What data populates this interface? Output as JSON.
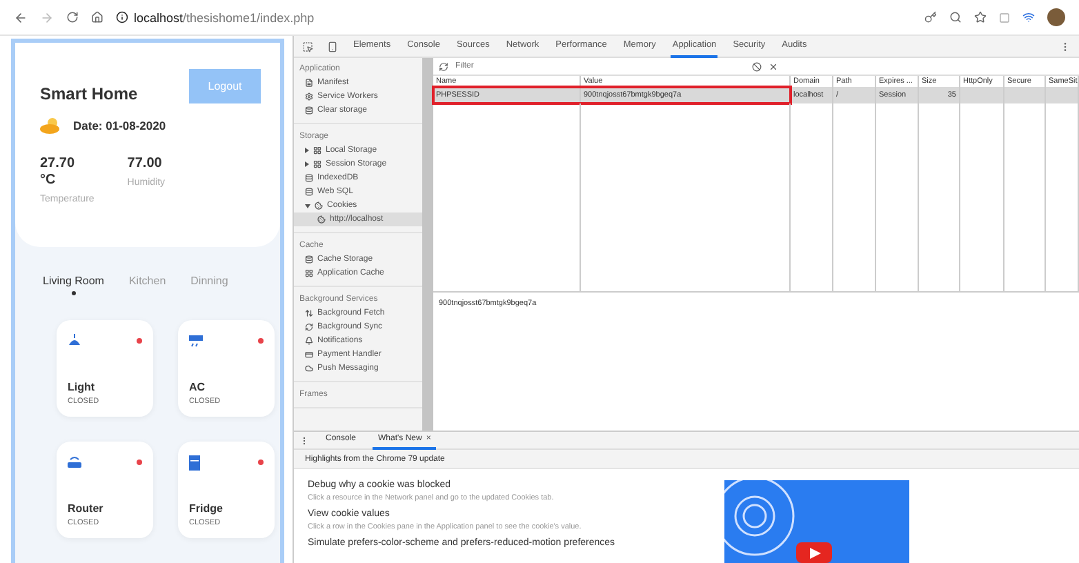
{
  "browser": {
    "url_host": "localhost",
    "url_path": "/thesishome1/index.php"
  },
  "app": {
    "title": "Smart Home",
    "logout": "Logout",
    "date": "Date: 01-08-2020",
    "readings": [
      {
        "value": "27.70 °C",
        "label": "Temperature"
      },
      {
        "value": "77.00",
        "label": "Humidity"
      }
    ],
    "rooms": [
      {
        "label": "Living Room",
        "selected": true
      },
      {
        "label": "Kitchen",
        "selected": false
      },
      {
        "label": "Dinning",
        "selected": false
      }
    ],
    "devices": [
      {
        "kind": "lamp",
        "name": "Light",
        "status": "CLOSED",
        "on": false
      },
      {
        "kind": "ac",
        "name": "AC",
        "status": "CLOSED",
        "on": false
      },
      {
        "kind": "router",
        "name": "Router",
        "status": "CLOSED",
        "on": false
      },
      {
        "kind": "fridge",
        "name": "Fridge",
        "status": "CLOSED",
        "on": false
      }
    ]
  },
  "devtools": {
    "tabs": [
      {
        "label": "Elements",
        "selected": false
      },
      {
        "label": "Console",
        "selected": false
      },
      {
        "label": "Sources",
        "selected": false
      },
      {
        "label": "Network",
        "selected": false
      },
      {
        "label": "Performance",
        "selected": false
      },
      {
        "label": "Memory",
        "selected": false
      },
      {
        "label": "Application",
        "selected": true
      },
      {
        "label": "Security",
        "selected": false
      },
      {
        "label": "Audits",
        "selected": false
      }
    ],
    "sidebar": [
      {
        "title": "Application",
        "items": [
          {
            "kind": "document",
            "label": "Manifest",
            "selected": false
          },
          {
            "kind": "gear",
            "label": "Service Workers",
            "selected": false
          },
          {
            "kind": "storage",
            "label": "Clear storage",
            "selected": false
          }
        ]
      },
      {
        "title": "Storage",
        "items": [
          {
            "kind": "table",
            "label": "Local Storage",
            "selected": false,
            "expanded": false
          },
          {
            "kind": "table",
            "label": "Session Storage",
            "selected": false,
            "expanded": false
          },
          {
            "kind": "storage",
            "label": "IndexedDB",
            "selected": false
          },
          {
            "kind": "storage",
            "label": "Web SQL",
            "selected": false
          },
          {
            "kind": "cookie",
            "label": "Cookies",
            "selected": false,
            "expanded": true,
            "children": [
              {
                "kind": "cookie",
                "label": "http://localhost",
                "selected": true
              }
            ]
          }
        ]
      },
      {
        "title": "Cache",
        "items": [
          {
            "kind": "storage",
            "label": "Cache Storage",
            "selected": false
          },
          {
            "kind": "table",
            "label": "Application Cache",
            "selected": false
          }
        ]
      },
      {
        "title": "Background Services",
        "items": [
          {
            "kind": "fetch",
            "label": "Background Fetch",
            "selected": false
          },
          {
            "kind": "sync",
            "label": "Background Sync",
            "selected": false
          },
          {
            "kind": "bell",
            "label": "Notifications",
            "selected": false
          },
          {
            "kind": "card",
            "label": "Payment Handler",
            "selected": false
          },
          {
            "kind": "cloud",
            "label": "Push Messaging",
            "selected": false
          }
        ]
      },
      {
        "title": "Frames"
      }
    ],
    "filter": {
      "placeholder": "Filter"
    },
    "table": {
      "columns": [
        "Name",
        "Value",
        "Domain",
        "Path",
        "Expires ...",
        "Size",
        "HttpOnly",
        "Secure",
        "SameSit"
      ],
      "rows": [
        {
          "cells": [
            "PHPSESSID",
            "900tnqjosst67bmtgk9bgeq7a",
            "localhost",
            "/",
            "Session",
            "35",
            "",
            "",
            ""
          ],
          "selected": true,
          "highlighted": true
        }
      ]
    },
    "preview": "900tnqjosst67bmtgk9bgeq7a",
    "drawer": {
      "tabs": [
        {
          "label": "Console",
          "selected": false,
          "closable": false
        },
        {
          "label": "What's New",
          "selected": true,
          "closable": true
        }
      ],
      "close_glyph": "×",
      "banner": "Highlights from the Chrome 79 update",
      "items": [
        {
          "title": "Debug why a cookie was blocked",
          "text": "Click a resource in the Network panel and go to the updated Cookies tab."
        },
        {
          "title": "View cookie values",
          "text": "Click a row in the Cookies pane in the Application panel to see the cookie's value."
        },
        {
          "title": "Simulate prefers-color-scheme and prefers-reduced-motion preferences"
        }
      ]
    }
  }
}
